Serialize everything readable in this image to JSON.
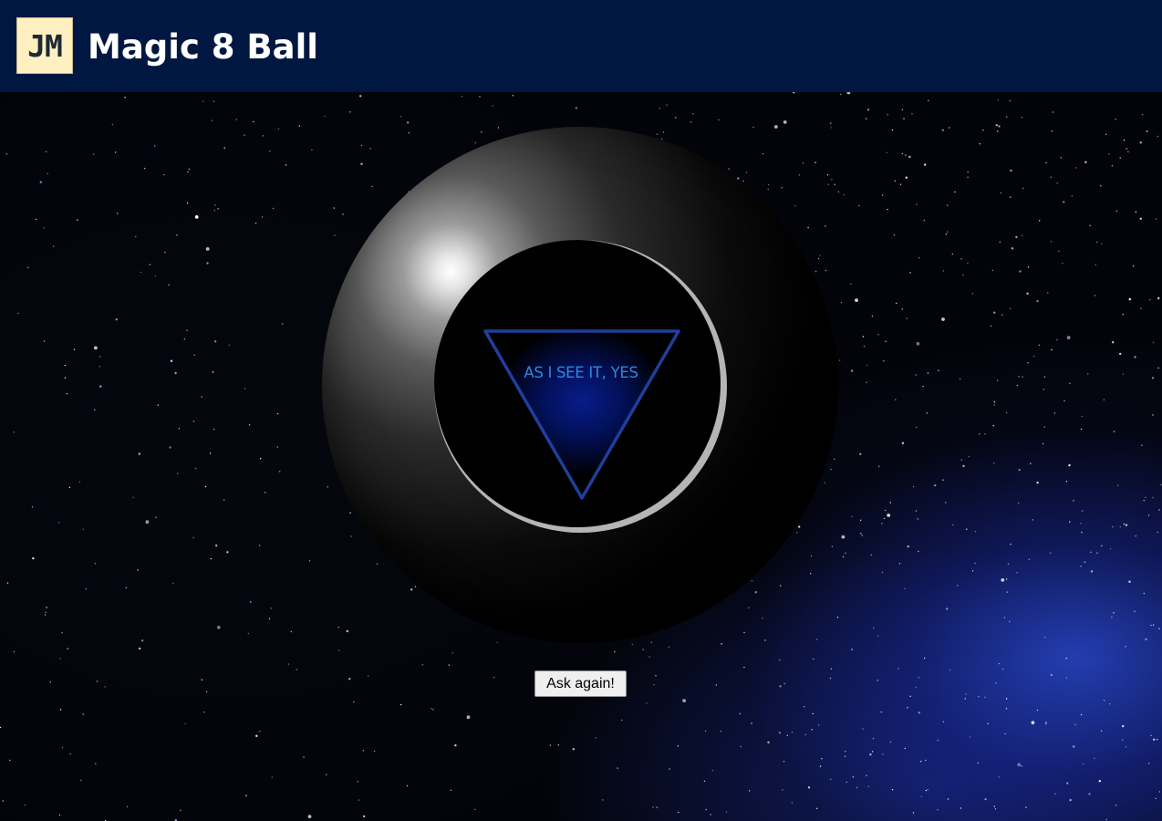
{
  "header": {
    "logo_text": "JM",
    "title": "Magic 8 Ball"
  },
  "ball": {
    "answer": "AS I SEE IT, YES"
  },
  "controls": {
    "ask_label": "Ask again!"
  },
  "colors": {
    "header_bg": "#001841",
    "logo_bg": "#fff0c2",
    "triangle_stroke": "#1f3f9c",
    "answer_text": "#2c88e0",
    "button_bg": "#efefef"
  }
}
